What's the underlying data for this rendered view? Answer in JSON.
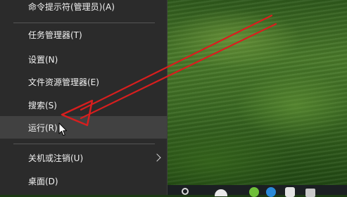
{
  "context_menu": {
    "items": [
      {
        "label": "命令提示符(管理员)(A)"
      },
      {
        "label": "任务管理器(T)"
      },
      {
        "label": "设置(N)"
      },
      {
        "label": "文件资源管理器(E)"
      },
      {
        "label": "搜索(S)"
      },
      {
        "label": "运行(R)",
        "state": "hovered"
      },
      {
        "label": "关机或注销(U)",
        "has_submenu": true
      },
      {
        "label": "桌面(D)"
      }
    ]
  },
  "annotation": {
    "type": "arrow",
    "color": "#d81e1e",
    "points_to": "运行(R)"
  },
  "colors": {
    "menu_background": "#2b2b2b",
    "hover_background": "#414141",
    "text": "#f2f2f2",
    "separator": "#555555",
    "taskbar": "#1b1f22"
  },
  "icons": [
    "chevron-right-icon",
    "mouse-pointer-icon",
    "red-arrow-annotation"
  ]
}
